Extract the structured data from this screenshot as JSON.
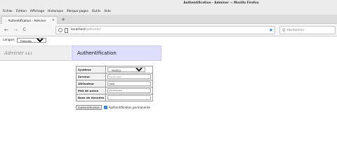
{
  "window": {
    "title": "Authentification - Adminer — Mozilla Firefox"
  },
  "menubar": {
    "items": [
      "Fichier",
      "Édition",
      "Affichage",
      "Historique",
      "Marque-pages",
      "Outils",
      "Aide"
    ]
  },
  "tabs": [
    {
      "label": "Authentification - Adminer"
    }
  ],
  "toolbar": {
    "back_glyph": "←",
    "forward_glyph": "→",
    "reload_glyph": "C",
    "new_tab_glyph": "+",
    "close_glyph": "×"
  },
  "url": {
    "host": "localhost",
    "path": "/adminer/"
  },
  "search": {
    "placeholder": "Rechercher"
  },
  "lang": {
    "label": "Langue:",
    "selected": "Français"
  },
  "app": {
    "name": "Adminer",
    "version": "4.8.1"
  },
  "login": {
    "heading": "Authentification",
    "fields": [
      {
        "label": "Système",
        "value": "MySQL"
      },
      {
        "label": "Serveur",
        "placeholder": "localhost",
        "value": ""
      },
      {
        "label": "Utilisateur",
        "value": "root"
      },
      {
        "label": "Mot de passe",
        "value": "••••••••"
      },
      {
        "label": "Base de données",
        "value": ""
      }
    ],
    "submit_label": "Authentification",
    "permanent_label": "Authentification permanente",
    "permanent_checked": true
  },
  "colors": {
    "accent": "#2f7bd8",
    "header_bg": "#dedeff",
    "menu_bg": "#eeeeee"
  },
  "icons": {
    "tab": "page-icon",
    "star": "star-icon",
    "search": "search-icon",
    "info": "info-icon"
  }
}
